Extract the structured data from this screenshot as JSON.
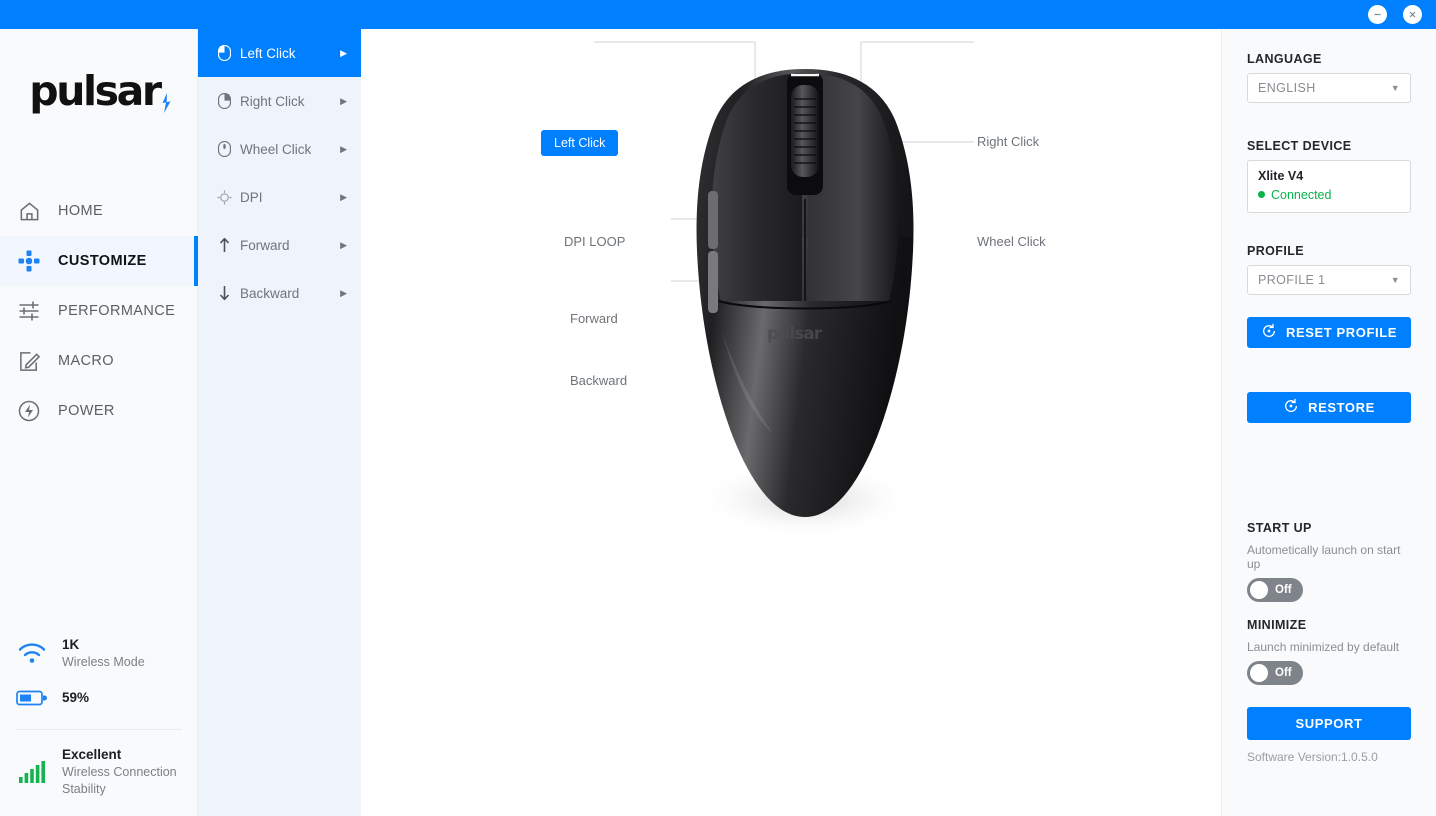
{
  "titlebar": {
    "minimize_label": "minimize",
    "close_label": "close",
    "bg": "#007fff"
  },
  "sidebar": {
    "logo_text": "pulsar",
    "nav": [
      {
        "label": "HOME",
        "icon": "home-icon",
        "active": false
      },
      {
        "label": "CUSTOMIZE",
        "icon": "dpad-icon",
        "active": true
      },
      {
        "label": "PERFORMANCE",
        "icon": "sliders-icon",
        "active": false
      },
      {
        "label": "MACRO",
        "icon": "pencil-square-icon",
        "active": false
      },
      {
        "label": "POWER",
        "icon": "power-icon",
        "active": false
      }
    ],
    "status": {
      "wireless_value": "1K",
      "wireless_label": "Wireless Mode",
      "battery_value": "59%",
      "stability_value": "Excellent",
      "stability_label": "Wireless Connection Stability"
    }
  },
  "subpanel": {
    "items": [
      {
        "label": "Left Click",
        "icon": "mouse-left-icon",
        "active": true
      },
      {
        "label": "Right Click",
        "icon": "mouse-right-icon",
        "active": false
      },
      {
        "label": "Wheel Click",
        "icon": "mouse-wheel-icon",
        "active": false
      },
      {
        "label": "DPI",
        "icon": "crosshair-icon",
        "active": false
      },
      {
        "label": "Forward",
        "icon": "arrow-up-icon",
        "active": false
      },
      {
        "label": "Backward",
        "icon": "arrow-down-icon",
        "active": false
      }
    ]
  },
  "stage": {
    "callouts": [
      {
        "label": "Left Click",
        "highlighted": true
      },
      {
        "label": "Right Click",
        "highlighted": false
      },
      {
        "label": "DPI LOOP",
        "highlighted": false
      },
      {
        "label": "Wheel Click",
        "highlighted": false
      },
      {
        "label": "Forward",
        "highlighted": false
      },
      {
        "label": "Backward",
        "highlighted": false
      }
    ],
    "device_brand": "pulsar"
  },
  "rightpanel": {
    "language_title": "LANGUAGE",
    "language_value": "ENGLISH",
    "device_title": "SELECT DEVICE",
    "device_name": "Xlite V4",
    "device_status": "Connected",
    "device_status_color": "#0bb14b",
    "profile_title": "PROFILE",
    "profile_value": "PROFILE 1",
    "reset_profile_label": "RESET PROFILE",
    "restore_label": "RESTORE",
    "startup_title": "START UP",
    "startup_desc": "Autometically launch on start up",
    "startup_toggle": "Off",
    "minimize_title": "MINIMIZE",
    "minimize_desc": "Launch minimized by default",
    "minimize_toggle": "Off",
    "support_label": "SUPPORT",
    "version": "Software Version:1.0.5.0"
  }
}
